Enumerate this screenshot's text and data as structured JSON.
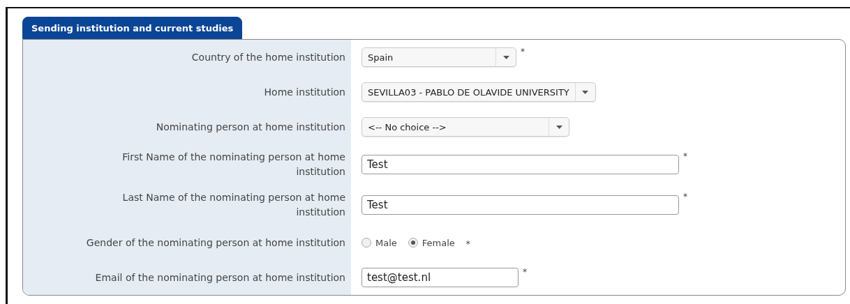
{
  "tab": {
    "label": "Sending institution and current studies",
    "selected": true
  },
  "rows": [
    {
      "kind": "select",
      "label": "Country of the home institution",
      "value": "Spain",
      "required_mark": "*"
    },
    {
      "kind": "select",
      "label": "Home institution",
      "value": "SEVILLA03 - PABLO DE OLAVIDE UNIVERSITY"
    },
    {
      "kind": "select",
      "label": "Nominating person at home institution",
      "value": "<-- No choice -->"
    },
    {
      "kind": "text",
      "label": "First Name of the nominating person at home institution",
      "value": "Test",
      "required_mark": "*"
    },
    {
      "kind": "text",
      "label": "Last Name of the nominating person at home institution",
      "value": "Test",
      "required_mark": "*"
    },
    {
      "kind": "radio",
      "label": "Gender of the nominating person at home institution",
      "required_mark": "*",
      "options": [
        {
          "label": "Male",
          "selected": false
        },
        {
          "label": "Female",
          "selected": true
        }
      ]
    },
    {
      "kind": "text",
      "label": "Email of the nominating person at home institution",
      "value": "test@test.nl",
      "required_mark": "*"
    }
  ]
}
